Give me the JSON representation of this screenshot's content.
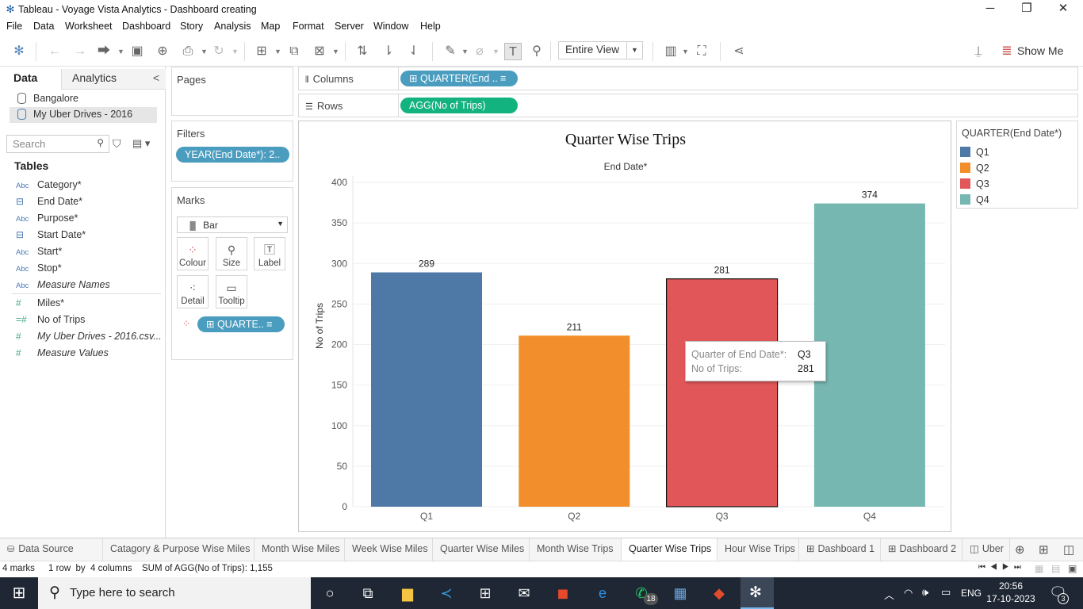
{
  "window": {
    "title": "Tableau - Voyage Vista Analytics - Dashboard creating",
    "minimize": "─",
    "maximize": "❐",
    "close": "✕"
  },
  "menu": [
    "File",
    "Data",
    "Worksheet",
    "Dashboard",
    "Story",
    "Analysis",
    "Map",
    "Format",
    "Server",
    "Window",
    "Help"
  ],
  "toolbar": {
    "fit_label": "Entire View",
    "show_me": "Show Me"
  },
  "data_pane": {
    "tab_data": "Data",
    "tab_analytics": "Analytics",
    "collapse": "<",
    "sources": [
      "Bangalore",
      "My Uber Drives - 2016"
    ],
    "search_placeholder": "Search",
    "tables_header": "Tables",
    "dimensions": [
      {
        "type": "Abc",
        "name": "Category*"
      },
      {
        "type": "date",
        "name": "End Date*"
      },
      {
        "type": "Abc",
        "name": "Purpose*"
      },
      {
        "type": "date",
        "name": "Start Date*"
      },
      {
        "type": "Abc",
        "name": "Start*"
      },
      {
        "type": "Abc",
        "name": "Stop*"
      },
      {
        "type": "Abc",
        "name": "Measure Names"
      }
    ],
    "measures": [
      {
        "type": "#",
        "name": "Miles*"
      },
      {
        "type": "=#",
        "name": "No of Trips"
      },
      {
        "type": "#",
        "name": "My Uber Drives - 2016.csv..."
      },
      {
        "type": "#",
        "name": "Measure Values"
      }
    ]
  },
  "cards": {
    "pages_title": "Pages",
    "filters_title": "Filters",
    "filter_pill": "YEAR(End Date*): 2..",
    "marks_title": "Marks",
    "mark_type": "Bar",
    "mark_buttons": [
      "Colour",
      "Size",
      "Label",
      "Detail",
      "Tooltip"
    ],
    "marks_pill": "QUARTE..",
    "columns_label": "Columns",
    "rows_label": "Rows",
    "columns_pill": "QUARTER(End ..",
    "rows_pill": "AGG(No of Trips)"
  },
  "legend": {
    "title": "QUARTER(End Date*)",
    "items": [
      {
        "label": "Q1",
        "color": "#4e79a7"
      },
      {
        "label": "Q2",
        "color": "#f28e2b"
      },
      {
        "label": "Q3",
        "color": "#e15759"
      },
      {
        "label": "Q4",
        "color": "#76b7b2"
      }
    ]
  },
  "chart_data": {
    "type": "bar",
    "title": "Quarter Wise Trips",
    "column_header": "End Date*",
    "ylabel": "No of Trips",
    "categories": [
      "Q1",
      "Q2",
      "Q3",
      "Q4"
    ],
    "values": [
      289,
      211,
      281,
      374
    ],
    "colors": [
      "#4e79a7",
      "#f28e2b",
      "#e15759",
      "#76b7b2"
    ],
    "ylim": [
      0,
      400
    ],
    "yticks": [
      0,
      50,
      100,
      150,
      200,
      250,
      300,
      350,
      400
    ],
    "grid": true,
    "selected": "Q3"
  },
  "tooltip": {
    "row1_key": "Quarter of End Date*:",
    "row1_val": "Q3",
    "row2_key": "No of Trips:",
    "row2_val": "281"
  },
  "sheet_tabs": [
    {
      "label": "Data Source",
      "active": false
    },
    {
      "label": "Catagory & Purpose Wise Miles",
      "active": false
    },
    {
      "label": "Month Wise Miles",
      "active": false
    },
    {
      "label": "Week Wise Miles",
      "active": false
    },
    {
      "label": "Quarter Wise Miles",
      "active": false
    },
    {
      "label": "Month Wise Trips",
      "active": false
    },
    {
      "label": "Quarter Wise Trips",
      "active": true
    },
    {
      "label": "Hour Wise Trips",
      "active": false
    },
    {
      "label": "Dashboard 1",
      "active": false
    },
    {
      "label": "Dashboard 2",
      "active": false
    },
    {
      "label": "Uber",
      "active": false
    }
  ],
  "status": {
    "marks": "4 marks",
    "rows_cols": "1 row  by  4 columns",
    "sum": "SUM of AGG(No of Trips): 1,155"
  },
  "taskbar": {
    "search_placeholder": "Type here to search",
    "whatsapp_badge": "18",
    "lang": "ENG",
    "time": "20:56",
    "date": "17-10-2023",
    "notif_count": "3"
  }
}
